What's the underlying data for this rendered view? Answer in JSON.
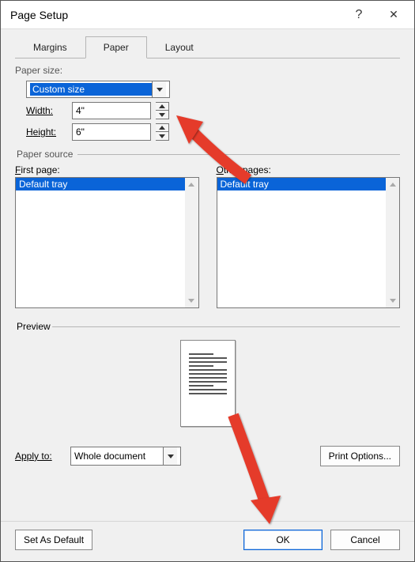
{
  "title": "Page Setup",
  "tabs": {
    "margins": "Margins",
    "paper": "Paper",
    "layout": "Layout"
  },
  "paper_size": {
    "label": "Paper size:",
    "selected": "Custom size",
    "width_label_pre": "W",
    "width_label_u": "i",
    "width_label_post": "dth:",
    "width_value": "4\"",
    "height_label_pre": "H",
    "height_label_u": "e",
    "height_label_post": "ight:",
    "height_value": "6\""
  },
  "source": {
    "legend": "Paper source",
    "first_label_u": "F",
    "first_label_post": "irst page:",
    "first_items": [
      "Default tray"
    ],
    "other_label_u": "O",
    "other_label_post": "ther pages:",
    "other_items": [
      "Default tray"
    ]
  },
  "preview_label": "Preview",
  "apply": {
    "label_pre": "Appl",
    "label_u": "y",
    "label_post": " to:",
    "selected": "Whole document"
  },
  "buttons": {
    "print_options": "Print Options...",
    "set_default": "Set As Default",
    "ok": "OK",
    "cancel": "Cancel"
  }
}
